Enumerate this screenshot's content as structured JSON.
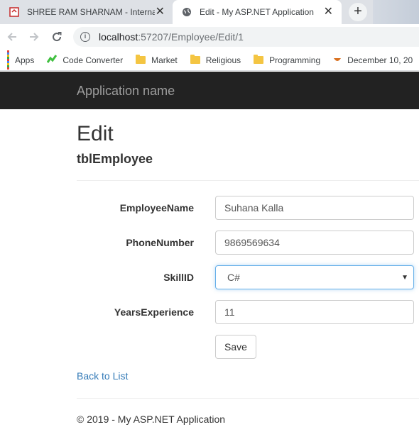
{
  "browser": {
    "tabs": [
      {
        "title": "SHREE RAM SHARNAM - Internat",
        "close": "✕"
      },
      {
        "title": "Edit - My ASP.NET Application",
        "close": "✕"
      }
    ],
    "new_tab": "+",
    "url_host": "localhost",
    "url_path": ":57207/Employee/Edit/1",
    "bookmarks": [
      {
        "label": "Apps",
        "icon": "apps-grid-icon"
      },
      {
        "label": "Code Converter",
        "icon": "code-converter-icon"
      },
      {
        "label": "Market",
        "icon": "folder-icon"
      },
      {
        "label": "Religious",
        "icon": "folder-icon"
      },
      {
        "label": "Programming",
        "icon": "folder-icon"
      },
      {
        "label": "December 10, 20",
        "icon": "bookmark-page-icon"
      }
    ]
  },
  "navbar": {
    "brand": "Application name"
  },
  "page": {
    "title": "Edit",
    "subtitle": "tblEmployee",
    "fields": {
      "employee_name": {
        "label": "EmployeeName",
        "value": "Suhana Kalla"
      },
      "phone_number": {
        "label": "PhoneNumber",
        "value": "9869569634"
      },
      "skill_id": {
        "label": "SkillID",
        "value": "C#"
      },
      "years_experience": {
        "label": "YearsExperience",
        "value": "11"
      }
    },
    "save_label": "Save",
    "back_link": "Back to List",
    "footer": "© 2019 - My ASP.NET Application"
  },
  "colors": {
    "navbar_bg": "#222222",
    "link": "#337ab7",
    "focus_border": "#66afe9"
  }
}
